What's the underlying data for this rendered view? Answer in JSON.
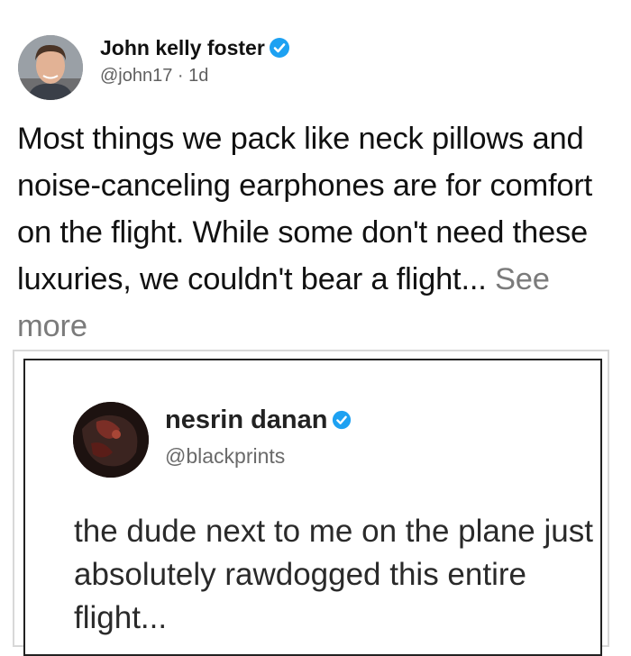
{
  "tweet": {
    "author_name": "John kelly foster",
    "handle": "@john17",
    "time": "1d",
    "body": "Most things we pack like neck pillows and noise-canceling earphones are for comfort on the flight. While some don't need these luxuries, we couldn't bear a flight...",
    "see_more_label": "See more",
    "verified_icon": "verified-badge-icon"
  },
  "quoted_tweet": {
    "author_name": "nesrin danan",
    "handle": "@blackprints",
    "body": "the dude next to me on the plane just absolutely rawdogged this entire flight...",
    "verified_icon": "verified-badge-icon"
  },
  "colors": {
    "verified_blue": "#1da1f2",
    "text_primary": "#111111",
    "text_secondary": "#606060"
  }
}
